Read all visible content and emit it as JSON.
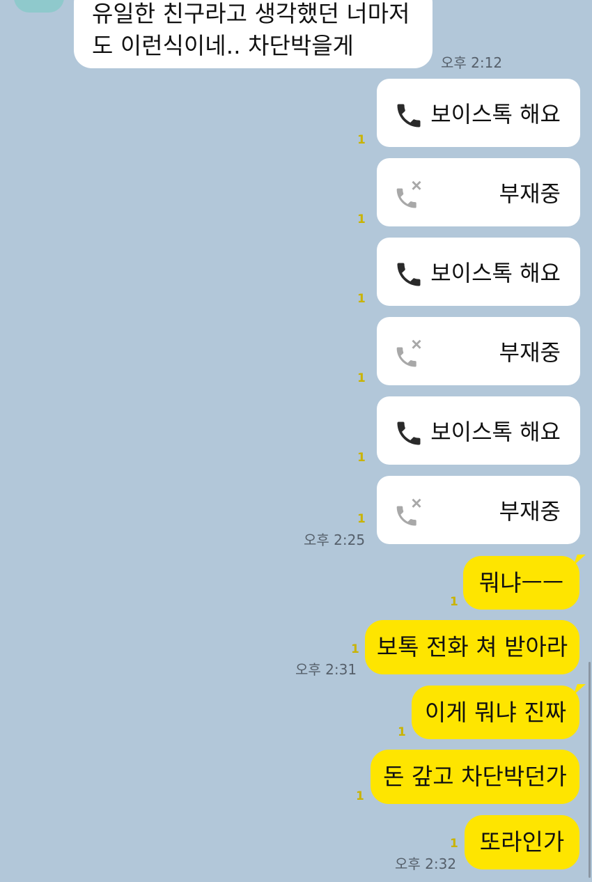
{
  "incoming": {
    "line1": "유일한 친구라고 생각했던 너마저",
    "line2": "도 이런식이네.. 차단박을게",
    "time": "오후 2:12"
  },
  "calls": [
    {
      "type": "voice",
      "label": "보이스톡 해요",
      "unread": "1",
      "icon": "phone-icon"
    },
    {
      "type": "missed",
      "label": "부재중",
      "unread": "1",
      "icon": "missed-call-icon"
    },
    {
      "type": "voice",
      "label": "보이스톡 해요",
      "unread": "1",
      "icon": "phone-icon"
    },
    {
      "type": "missed",
      "label": "부재중",
      "unread": "1",
      "icon": "missed-call-icon"
    },
    {
      "type": "voice",
      "label": "보이스톡 해요",
      "unread": "1",
      "icon": "phone-icon"
    },
    {
      "type": "missed",
      "label": "부재중",
      "unread": "1",
      "icon": "missed-call-icon"
    }
  ],
  "calls_time": "오후 2:25",
  "outgoing": [
    {
      "text": "뭐냐ㅡㅡ",
      "unread": "1"
    },
    {
      "text": "보톡 전화 쳐 받아라",
      "unread": "1",
      "time": "오후 2:31"
    },
    {
      "text": "이게 뭐냐 진짜",
      "unread": "1"
    },
    {
      "text": "돈 갚고 차단박던가",
      "unread": "1"
    },
    {
      "text": "또라인가",
      "unread": "1",
      "time": "오후 2:32"
    }
  ],
  "colors": {
    "background": "#b2c7d9",
    "outgoing_bubble": "#fee500",
    "incoming_bubble": "#ffffff",
    "unread": "#c9b300"
  }
}
